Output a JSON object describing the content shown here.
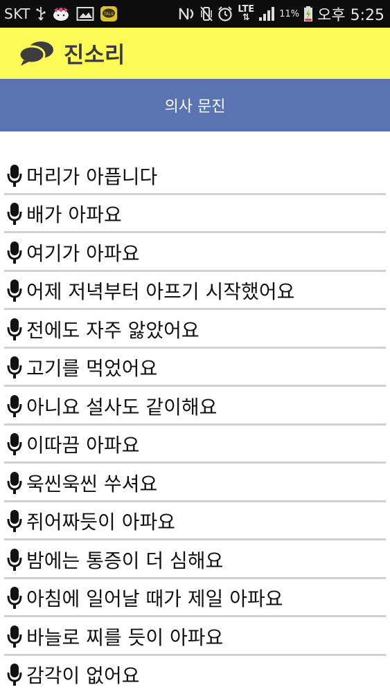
{
  "status_bar": {
    "carrier": "SKT",
    "network": "LTE",
    "battery": "11%",
    "time": "오후 5:25"
  },
  "app": {
    "title": "진소리",
    "logo_icon": "chat-bubbles-icon"
  },
  "tab": {
    "label": "의사 문진"
  },
  "phrases": [
    "머리가 아픕니다",
    "배가 아파요",
    "여기가 아파요",
    "어제 저녁부터 아프기 시작했어요",
    "전에도 자주 앓았어요",
    "고기를 먹었어요",
    "아니요 설사도 같이해요",
    "이따끔 아파요",
    "욱씬욱씬 쑤셔요",
    "쥐어짜듯이 아파요",
    "밤에는 통증이 더 심해요",
    "아침에 일어날 때가 제일 아파요",
    "바늘로 찌를 듯이 아파요",
    "감각이 없어요"
  ],
  "colors": {
    "appbar": "#fdfb55",
    "tabbar": "#5a74b2",
    "divider": "#d0d0d0"
  }
}
